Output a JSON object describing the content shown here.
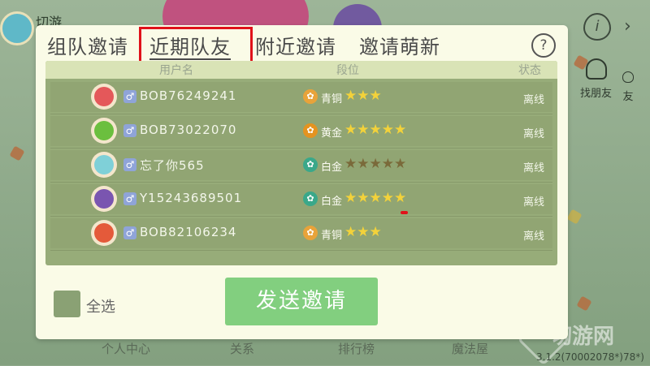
{
  "background": {
    "title": "切游",
    "info_label": "i",
    "chevron": "›",
    "side_buttons": [
      {
        "label": "找朋友",
        "icon": "add-friend-icon"
      },
      {
        "label": "友",
        "icon": "friend-icon"
      }
    ],
    "bottom_nav": [
      "个人中心",
      "关系",
      "排行榜",
      "魔法屋"
    ],
    "version": "3.1.2(70002078*)78*)",
    "watermark": "切游网"
  },
  "dialog": {
    "tabs": [
      {
        "label": "组队邀请",
        "active": false
      },
      {
        "label": "近期队友",
        "active": true
      },
      {
        "label": "附近邀请",
        "active": false
      },
      {
        "label": "邀请萌新",
        "active": false
      }
    ],
    "help_label": "?",
    "table": {
      "headers": [
        "用户名",
        "段位",
        "状态"
      ],
      "rows": [
        {
          "name": "BOB76249241",
          "gender": "♂",
          "rank": "青铜",
          "rank_color": "#e8a33a",
          "stars_filled": 3,
          "stars_total": 3,
          "status": "离线",
          "avatar_color": "#e4585a"
        },
        {
          "name": "BOB73022070",
          "gender": "♂",
          "rank": "黄金",
          "rank_color": "#e49320",
          "stars_filled": 5,
          "stars_total": 5,
          "status": "离线",
          "avatar_color": "#6bbf3e"
        },
        {
          "name": "忘了你565",
          "gender": "♂",
          "rank": "白金",
          "rank_color": "#3aa88a",
          "stars_filled": 0,
          "stars_total": 5,
          "status": "离线",
          "avatar_color": "#7fd0d8"
        },
        {
          "name": "Y15243689501",
          "gender": "♂",
          "rank": "白金",
          "rank_color": "#3aa88a",
          "stars_filled": 5,
          "stars_total": 5,
          "status": "离线",
          "avatar_color": "#7a55b0"
        },
        {
          "name": "BOB82106234",
          "gender": "♂",
          "rank": "青铜",
          "rank_color": "#e8a33a",
          "stars_filled": 3,
          "stars_total": 3,
          "status": "离线",
          "avatar_color": "#e45a3a"
        }
      ]
    },
    "select_all_label": "全选",
    "send_button_label": "发送邀请"
  },
  "colors": {
    "accent_green": "#82cf7f",
    "highlight_red": "#e0121a",
    "star_gold": "#f3d23a",
    "star_empty": "#7a6a3a"
  }
}
